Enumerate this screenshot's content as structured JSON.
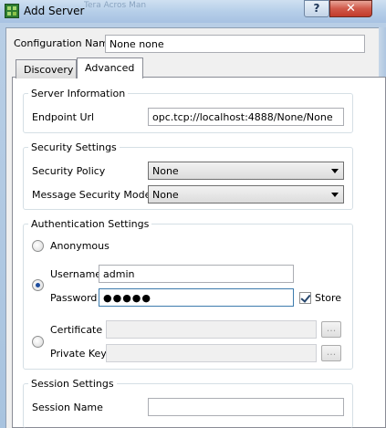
{
  "window": {
    "title": "Add Server",
    "ghost_title": "Tera Acros Man",
    "help_label": "?",
    "close_label": "✕"
  },
  "config": {
    "name_label": "Configuration Name",
    "name_value": "None none"
  },
  "tabs": [
    {
      "label": "Discovery",
      "active": false
    },
    {
      "label": "Advanced",
      "active": true
    }
  ],
  "server_info": {
    "group_title": "Server Information",
    "endpoint_label": "Endpoint Url",
    "endpoint_value": "opc.tcp://localhost:4888/None/None"
  },
  "security": {
    "group_title": "Security Settings",
    "policy_label": "Security Policy",
    "policy_value": "None",
    "mode_label": "Message Security Mode",
    "mode_value": "None"
  },
  "auth": {
    "group_title": "Authentication Settings",
    "anonymous_label": "Anonymous",
    "username_label": "Username",
    "username_value": "admin",
    "password_label": "Password",
    "password_value": "●●●●●",
    "store_label": "Store",
    "store_checked": true,
    "certificate_label": "Certificate",
    "private_key_label": "Private Key",
    "browse_label": "...",
    "selected": "username"
  },
  "session": {
    "group_title": "Session Settings",
    "name_label": "Session Name",
    "name_value": ""
  }
}
